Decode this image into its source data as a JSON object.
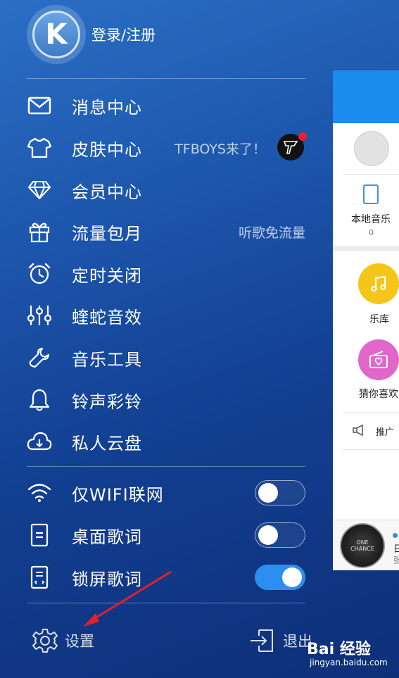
{
  "header": {
    "avatar_letter": "K",
    "login_label": "登录/注册"
  },
  "menu": [
    {
      "label": "消息中心",
      "icon": "mail-icon"
    },
    {
      "label": "皮肤中心",
      "icon": "shirt-icon",
      "extra": "TFBOYS来了！",
      "badge": "tfboys-badge"
    },
    {
      "label": "会员中心",
      "icon": "diamond-icon"
    },
    {
      "label": "流量包月",
      "icon": "gift-icon",
      "extra": "听歌免流量"
    },
    {
      "label": "定时关闭",
      "icon": "alarm-clock-icon"
    },
    {
      "label": "蝰蛇音效",
      "icon": "equalizer-icon"
    },
    {
      "label": "音乐工具",
      "icon": "wrench-icon"
    },
    {
      "label": "铃声彩铃",
      "icon": "bell-icon"
    },
    {
      "label": "私人云盘",
      "icon": "cloud-icon"
    }
  ],
  "toggles": [
    {
      "label": "仅WIFI联网",
      "icon": "wifi-icon",
      "on": false
    },
    {
      "label": "桌面歌词",
      "icon": "desktop-lyrics-icon",
      "on": false
    },
    {
      "label": "锁屏歌词",
      "icon": "lock-lyrics-icon",
      "on": true
    }
  ],
  "footer": {
    "settings_label": "设置",
    "exit_label": "退出"
  },
  "peek": {
    "local_music": "本地音乐",
    "local_count": "0",
    "library": "乐库",
    "guess": "猜你喜欢",
    "promo": "推广"
  },
  "mini_player": {
    "cover_text": "ONE CHANCE",
    "title_fragment": "日",
    "artist_fragment": "张"
  },
  "watermark": {
    "main": "Bai 经验",
    "sub": "jingyan.baidu.com"
  },
  "colors": {
    "accent": "#2c8ff0",
    "badge_red": "#e8202a",
    "library_yellow": "#f5c518",
    "guess_pink": "#e067c9"
  }
}
